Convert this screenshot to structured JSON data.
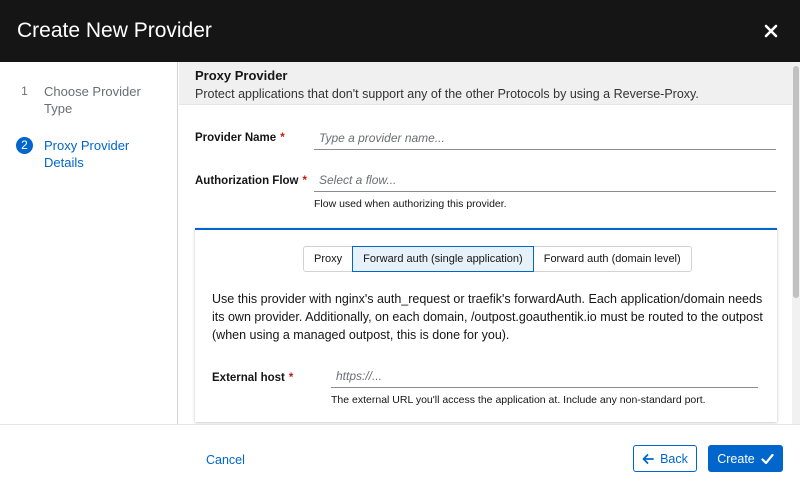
{
  "header": {
    "title": "Create New Provider",
    "close_icon": "close-icon"
  },
  "wizard": {
    "steps": [
      {
        "number": "1",
        "label": "Choose Provider Type",
        "state": "inactive"
      },
      {
        "number": "2",
        "label": "Proxy Provider Details",
        "state": "current"
      }
    ]
  },
  "section": {
    "title": "Proxy Provider",
    "description": "Protect applications that don't support any of the other Protocols by using a Reverse-Proxy."
  },
  "form": {
    "provider_name": {
      "label": "Provider Name",
      "required_mark": "*",
      "value": "",
      "placeholder": "Type a provider name..."
    },
    "authorization_flow": {
      "label": "Authorization Flow",
      "required_mark": "*",
      "placeholder": "Select a flow...",
      "helper": "Flow used when authorizing this provider."
    },
    "mode": {
      "options": [
        "Proxy",
        "Forward auth (single application)",
        "Forward auth (domain level)"
      ],
      "selected": "Forward auth (single application)",
      "description": "Use this provider with nginx's auth_request or traefik's forwardAuth. Each application/domain needs its own provider. Additionally, on each domain, /outpost.goauthentik.io must be routed to the outpost (when using a managed outpost, this is done for you)."
    },
    "external_host": {
      "label": "External host",
      "required_mark": "*",
      "value": "",
      "placeholder": "https://...",
      "helper": "The external URL you'll access the application at. Include any non-standard port."
    }
  },
  "footer": {
    "cancel_label": "Cancel",
    "back_label": "Back",
    "create_label": "Create"
  },
  "colors": {
    "accent": "#0066cc",
    "titlebar": "#151515",
    "required": "#c9190b"
  }
}
